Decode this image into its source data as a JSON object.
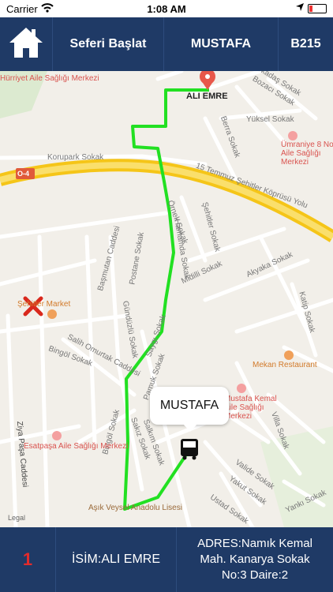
{
  "status": {
    "carrier": "Carrier",
    "time": "1:08 AM"
  },
  "topbar": {
    "start_label": "Seferi Başlat",
    "driver_label": "MUSTAFA",
    "bus_label": "B215"
  },
  "map": {
    "destination_label": "ALI EMRE",
    "bus_callout": "MUSTAFA",
    "legal": "Legal",
    "streets": {
      "korupark": "Korupark Sokak",
      "bridge_road": "15 Temmuz Şehitler Köprüsü Yolu",
      "d4": "O-4",
      "yuksel": "Yüksel Sokak",
      "berra": "Berra Sokak",
      "ornek": "Örnek Sokak",
      "sehit": "Şehitler Sokak",
      "midilli": "Midilli Sokak",
      "akyaka": "Akyaka Sokak",
      "postane": "Postane Sokak",
      "basmutan": "Başmutan Caddesi",
      "gunduzlu": "Gündüzlü Sokak",
      "saygi": "Saygı Sokak",
      "pamuk": "Pamuk Sokak",
      "salih": "Salih Omurtak Caddesi",
      "bingol1": "Bingöl Sokak",
      "bingol2": "Bingöl Sokak",
      "ziya": "Ziya Paşa Caddesi",
      "sakiz": "Sakız Sokak",
      "salkim": "Salkım Sokak",
      "valide": "Valide Sokak",
      "yakut": "Yakut Sokak",
      "ustad": "Ustad Sokak",
      "yanki": "Yankı Sokak",
      "villa": "Villa Sokak",
      "katip": "Katip Sokak",
      "arkadas": "Arkadaş Sokak",
      "bozaci": "Bozacı Sokak",
      "hamam": "Hamamda Sokak"
    },
    "pois": {
      "umraniye": "Ümraniye 8 Nolu Aile Sağlığı Merkezi",
      "esatpasa": "Esatpaşa Aile Sağlığı Merkezi",
      "mekan": "Mekan Restaurant",
      "mustafa_kemal": "Mustafa Kemal Aile Sağlığı Merkezi",
      "market": "Şehitler Market",
      "asik": "Aşık Veysel Anadolu Lisesi",
      "top_left": "Hürriyet Aile Sağlığı Merkezi"
    }
  },
  "bottombar": {
    "order_number": "1",
    "name_label": "İSİM:ALI EMRE",
    "address_line1": "ADRES:Namık Kemal",
    "address_line2": "Mah. Kanarya Sokak",
    "address_line3": "No:3 Daire:2"
  },
  "colors": {
    "bar": "#1f3a66",
    "route": "#22e022",
    "number": "#e32b2b"
  }
}
